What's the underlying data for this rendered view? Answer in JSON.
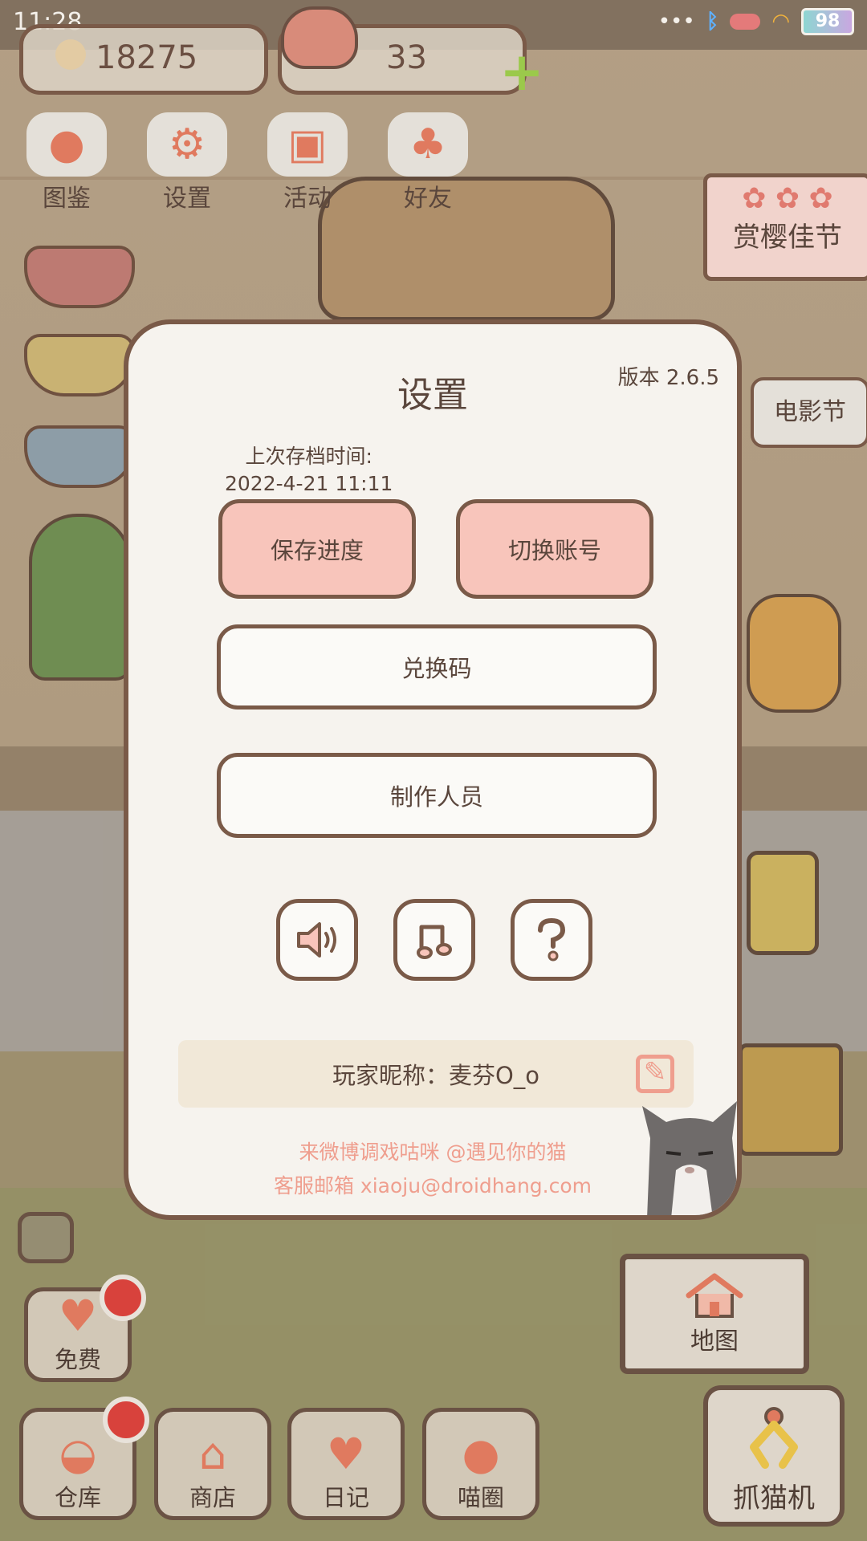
{
  "status_bar": {
    "time": "11:28",
    "battery": "98"
  },
  "currency": {
    "coins": "18275",
    "hearts": "33"
  },
  "top_menu": [
    {
      "label": "图鉴",
      "icon": "cat-face-icon"
    },
    {
      "label": "设置",
      "icon": "gear-icon"
    },
    {
      "label": "活动",
      "icon": "gift-icon"
    },
    {
      "label": "好友",
      "icon": "friends-icon"
    }
  ],
  "banners": {
    "festival": "赏樱佳节",
    "movie": "电影节"
  },
  "settings_dialog": {
    "title": "设置",
    "version": "版本 2.6.5",
    "save_time_label": "上次存档时间:",
    "save_time_value": "2022-4-21 11:11",
    "save_button": "保存进度",
    "switch_account_button": "切换账号",
    "redeem_code_button": "兑换码",
    "credits_button": "制作人员",
    "icon_buttons": [
      "speaker-icon",
      "music-note-icon",
      "help-question-icon"
    ],
    "nickname": "玩家昵称：麦芬O_o",
    "weibo_line": "来微博调戏咕咪 @遇见你的猫",
    "email_line": "客服邮箱 xiaoju@droidhang.com"
  },
  "bottom_nav": {
    "free": "免费",
    "warehouse": "仓库",
    "shop": "商店",
    "diary": "日记",
    "cat_circle": "喵圈",
    "map": "地图",
    "claw_machine": "抓猫机"
  },
  "colors": {
    "button_pink": "#f8c5bb",
    "outline_brown": "#7a5a48",
    "accent_salmon": "#ef9e8e",
    "dialog_bg": "#f6f3ee"
  }
}
